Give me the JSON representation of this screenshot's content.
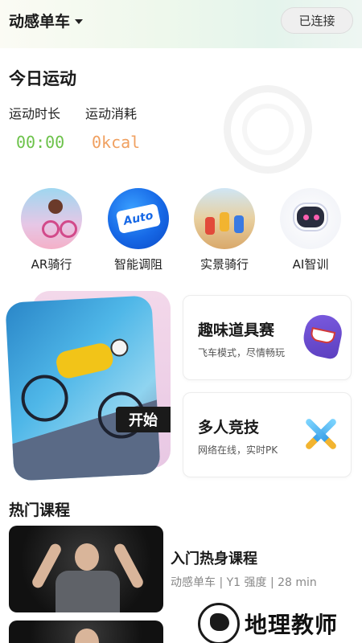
{
  "header": {
    "title": "动感单车",
    "connection_label": "已连接"
  },
  "today": {
    "title": "今日运动",
    "duration_label": "运动时长",
    "calories_label": "运动消耗",
    "duration_value": "00:00",
    "calories_value": "0kcal"
  },
  "features": [
    {
      "label": "AR骑行",
      "icon": "ar-riding-icon"
    },
    {
      "label": "智能调阻",
      "icon": "smart-resistance-icon",
      "badge": "Auto"
    },
    {
      "label": "实景骑行",
      "icon": "scenic-riding-icon"
    },
    {
      "label": "AI智训",
      "icon": "ai-training-icon"
    }
  ],
  "start_card": {
    "label": "开始"
  },
  "game_cards": [
    {
      "title": "趣味道具赛",
      "subtitle": "飞车模式，尽情畅玩",
      "icon": "shark-icon"
    },
    {
      "title": "多人竞技",
      "subtitle": "网络在线，实时PK",
      "icon": "crossed-swords-icon"
    }
  ],
  "hot_courses": {
    "title": "热门课程",
    "items": [
      {
        "name": "入门热身课程",
        "meta": "动感单车 | Y1 强度 | 28 min"
      }
    ]
  },
  "watermark": {
    "text": "地理教师"
  },
  "colors": {
    "duration": "#6cc24a",
    "calories": "#f0a060",
    "auto_blue": "#1668e6"
  }
}
